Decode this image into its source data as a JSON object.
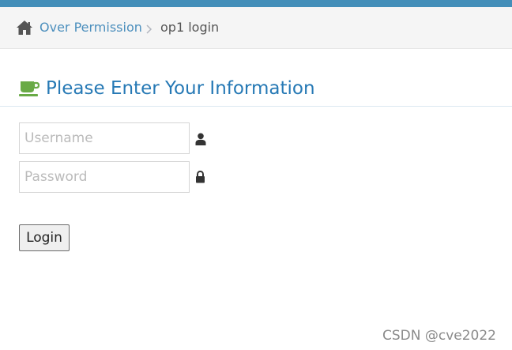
{
  "colors": {
    "top_bar": "#438eb9",
    "link": "#4c8fbd",
    "title": "#2679b5",
    "coffee_icon": "#69aa46"
  },
  "breadcrumb": {
    "home_icon": "home-icon",
    "link_label": "Over Permission",
    "separator_icon": "chevron-right-icon",
    "current": "op1 login"
  },
  "header": {
    "icon": "coffee-icon",
    "title": "Please Enter Your Information"
  },
  "form": {
    "username": {
      "value": "",
      "placeholder": "Username",
      "icon": "user-icon"
    },
    "password": {
      "value": "",
      "placeholder": "Password",
      "icon": "lock-icon"
    },
    "submit_label": "Login"
  },
  "watermark": "CSDN @cve2022"
}
